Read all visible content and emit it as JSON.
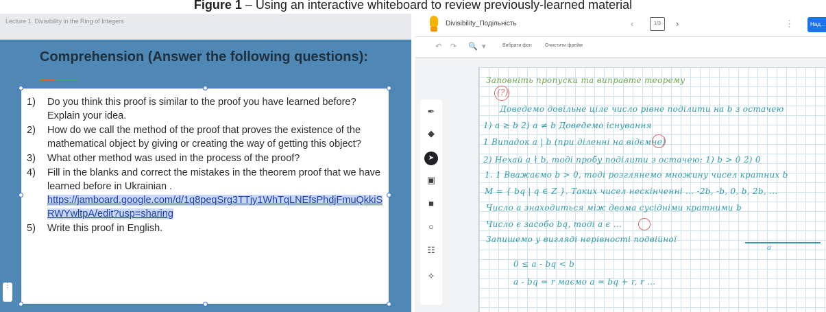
{
  "caption": {
    "bold": "Figure 1",
    "text": " – Using an interactive whiteboard to review previously-learned material"
  },
  "slide": {
    "breadcrumb": "Lecture 1. Divisibility in the Ring of Integers",
    "title": "Comprehension (Answer the following questions):",
    "questions": [
      {
        "num": "1)",
        "text": "Do you think this proof is similar to the proof  you have learned before?  Explain your idea."
      },
      {
        "num": "2)",
        "text": "How do we call the method of the proof that proves the existence of the mathematical object by giving or creating the way of getting this object?"
      },
      {
        "num": "3)",
        "text": "What other method was used in the process of the proof?"
      },
      {
        "num": "4)",
        "text": "Fill in the blanks and correct the mistakes in  the theorem proof that we have learned before in Ukrainian .",
        "link": "https://jamboard.google.com/d/1q8peqSrg3TTjy1WhTqLNEfsPhdjFmuQkkiSRWYwltpA/edit?usp=sharing"
      },
      {
        "num": "5)",
        "text": "Write this proof in English."
      }
    ],
    "side_tab": "⋮"
  },
  "jamboard": {
    "doc_title": "Divisibility_Подільність",
    "frame_indicator": "1/3",
    "prev_icon": "‹",
    "next_icon": "›",
    "more_icon": "⋮",
    "share_label": "Над...",
    "toolbar": {
      "undo": "↶",
      "redo": "↷",
      "zoom": "🔍",
      "zoom_caret": "▾",
      "set_background": "Вибрати фон",
      "clear_frame": "Очистити фрейм"
    },
    "tools": [
      {
        "name": "pen-icon",
        "glyph": "✒"
      },
      {
        "name": "eraser-icon",
        "glyph": "◆"
      },
      {
        "name": "select-icon",
        "glyph": "➤",
        "active": true
      },
      {
        "name": "sticky-note-icon",
        "glyph": "▣"
      },
      {
        "name": "add-image-icon",
        "glyph": "■"
      },
      {
        "name": "circle-shape-icon",
        "glyph": "○"
      },
      {
        "name": "text-box-icon",
        "glyph": "☷"
      },
      {
        "name": "laser-icon",
        "glyph": "✧"
      }
    ],
    "handwriting": [
      {
        "text": "Заповніть пропуски та виправте теорему",
        "color": "green"
      },
      {
        "text": "(?)",
        "color": "red"
      },
      {
        "text": "Доведемо довільне ціле число рівне поділити на b з остачею",
        "color": "blue"
      },
      {
        "text": "1) a ≥ b   2) a ≠ b   Доведемо існування",
        "color": "blue"
      },
      {
        "text": "1 Випадок a | b  (при діленні на відємне)",
        "color": "blue"
      },
      {
        "text": "2) Нехай a ∤ b, тоді пробу поділити з остачею:  1) b > 0  2) 0",
        "color": "blue"
      },
      {
        "text": "1. 1  Вважаємо b > 0, тоді розглянемо множину чисел кратних b",
        "color": "blue"
      },
      {
        "text": "M = { bq | q ∈ Z }.  Таких чисел нескінченні ... -2b, -b, 0, b, 2b, ...",
        "color": "blue"
      },
      {
        "text": "Число a знаходиться між двома сусідніми кратними b",
        "color": "blue"
      },
      {
        "text": "Число є засобо bq, тоді a є ...",
        "color": "blue"
      },
      {
        "text": "Запишемо у вигляді нерівності подвійної",
        "color": "blue"
      },
      {
        "text": "0 ≤ a - bq < b",
        "color": "blue"
      },
      {
        "text": "a - bq = r  маємо  a = bq + r, r ...",
        "color": "blue"
      }
    ],
    "number_line_label": "a"
  }
}
